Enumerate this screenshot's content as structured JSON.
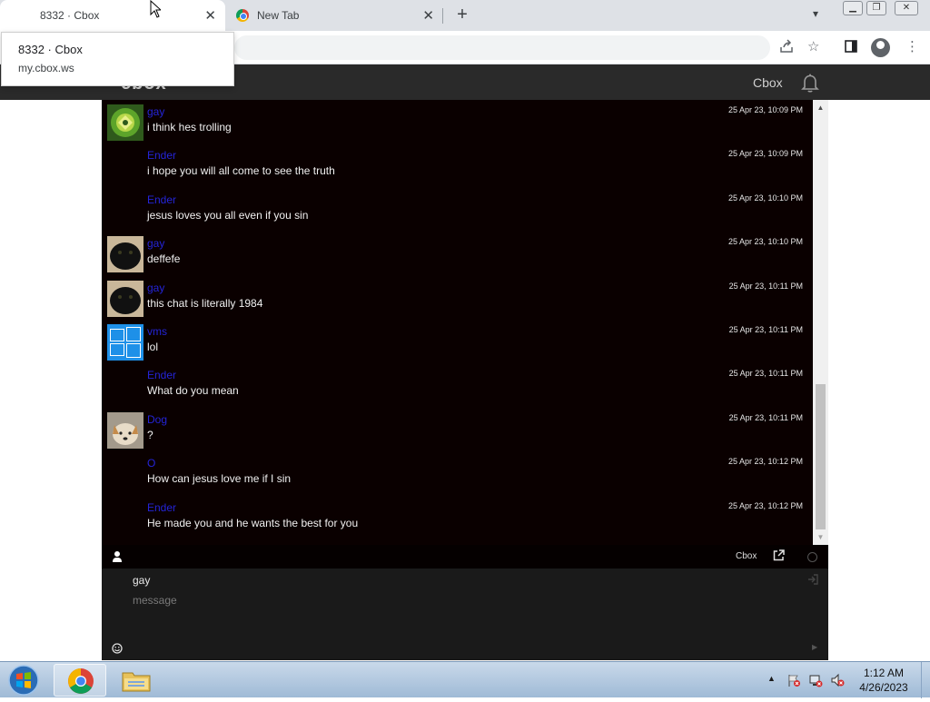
{
  "browser": {
    "tabs": [
      {
        "title": "8332 · Cbox",
        "active": true
      },
      {
        "title": "New Tab",
        "active": false
      }
    ],
    "tooltip": {
      "title": "8332 · Cbox",
      "url": "my.cbox.ws"
    }
  },
  "site": {
    "logo": "cbox",
    "header_link": "Cbox"
  },
  "messages": [
    {
      "name": "gay",
      "text": "i think hes trolling",
      "time": "25 Apr 23, 10:09 PM",
      "avatar": "green-emblem"
    },
    {
      "name": "Ender",
      "text": "i hope you will all come to see the truth",
      "time": "25 Apr 23, 10:09 PM",
      "avatar": "none"
    },
    {
      "name": "Ender",
      "text": "jesus loves you all even if you sin",
      "time": "25 Apr 23, 10:10 PM",
      "avatar": "none"
    },
    {
      "name": "gay",
      "text": "deffefe",
      "time": "25 Apr 23, 10:10 PM",
      "avatar": "black-cat"
    },
    {
      "name": "gay",
      "text": "this chat is literally 1984",
      "time": "25 Apr 23, 10:11 PM",
      "avatar": "black-cat"
    },
    {
      "name": "vms",
      "text": "lol",
      "time": "25 Apr 23, 10:11 PM",
      "avatar": "windows-logo"
    },
    {
      "name": "Ender",
      "text": "What do you mean",
      "time": "25 Apr 23, 10:11 PM",
      "avatar": "none"
    },
    {
      "name": "Dog",
      "text": "?",
      "time": "25 Apr 23, 10:11 PM",
      "avatar": "dog"
    },
    {
      "name": "O",
      "text": "How can jesus love me if I sin",
      "time": "25 Apr 23, 10:12 PM",
      "avatar": "none"
    },
    {
      "name": "Ender",
      "text": "He made you and he wants the best for you",
      "time": "25 Apr 23, 10:12 PM",
      "avatar": "none"
    }
  ],
  "chatbar": {
    "cbox_label": "Cbox"
  },
  "input": {
    "name_value": "gay",
    "message_placeholder": "message"
  },
  "taskbar": {
    "time": "1:12 AM",
    "date": "4/26/2023"
  },
  "colors": {
    "name_link": "#2424d8",
    "chat_bg": "#0a0000",
    "header_bg": "#2a2a2a"
  }
}
